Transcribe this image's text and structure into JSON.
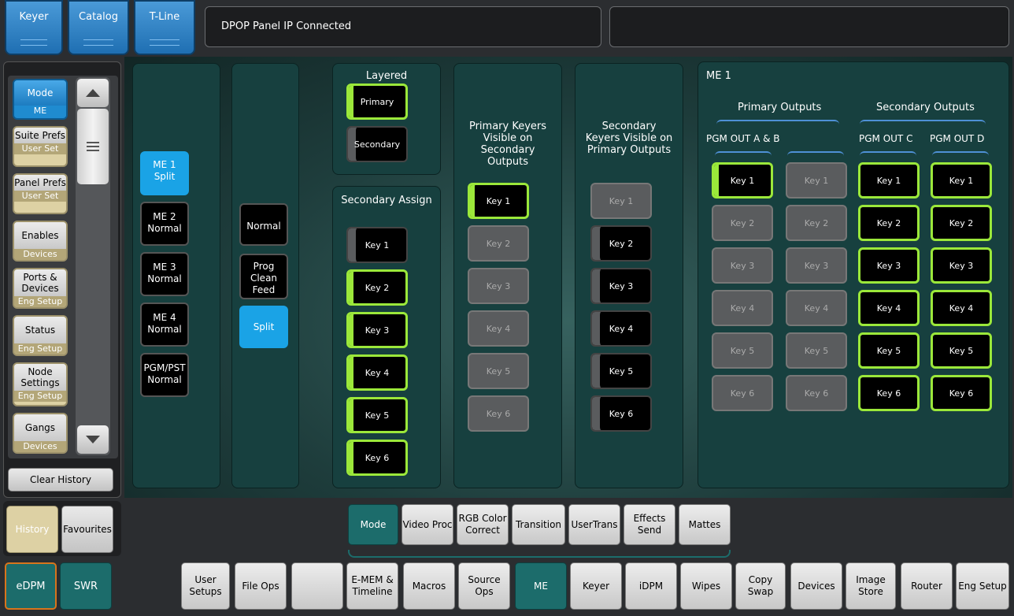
{
  "top_tabs": [
    "Keyer",
    "Catalog",
    "T-Line"
  ],
  "status_message": "DPOP Panel IP Connected",
  "sidebar": {
    "items": [
      {
        "label": "Mode",
        "sub": "ME"
      },
      {
        "label": "Suite Prefs",
        "sub": "User Set"
      },
      {
        "label": "Panel Prefs",
        "sub": "User Set"
      },
      {
        "label": "Enables",
        "sub": "Devices"
      },
      {
        "label": "Ports & Devices",
        "sub": "Eng Setup"
      },
      {
        "label": "Status",
        "sub": "Eng Setup"
      },
      {
        "label": "Node Settings",
        "sub": "Eng Setup"
      },
      {
        "label": "Gangs",
        "sub": "Devices"
      }
    ],
    "clear_history": "Clear History",
    "history": "History",
    "favourites": "Favourites",
    "edpm": "eDPM",
    "swr": "SWR"
  },
  "me_buttons": [
    {
      "line1": "ME 1",
      "line2": "Split"
    },
    {
      "line1": "ME 2",
      "line2": "Normal"
    },
    {
      "line1": "ME 3",
      "line2": "Normal"
    },
    {
      "line1": "ME 4",
      "line2": "Normal"
    },
    {
      "line1": "PGM/PST",
      "line2": "Normal"
    }
  ],
  "mode_buttons": [
    "Normal",
    "Prog Clean Feed",
    "Split"
  ],
  "layered": {
    "title": "Layered",
    "primary": "Primary",
    "secondary": "Secondary"
  },
  "secondary_assign": {
    "title": "Secondary Assign",
    "keys": [
      "Key 1",
      "Key 2",
      "Key 3",
      "Key 4",
      "Key 5",
      "Key 6"
    ]
  },
  "primary_visible": {
    "title": "Primary Keyers Visible on Secondary Outputs",
    "keys": [
      "Key 1",
      "Key 2",
      "Key 3",
      "Key 4",
      "Key 5",
      "Key 6"
    ]
  },
  "secondary_visible": {
    "title": "Secondary Keyers Visible on Primary Outputs",
    "keys": [
      "Key 1",
      "Key 2",
      "Key 3",
      "Key 4",
      "Key 5",
      "Key 6"
    ]
  },
  "me_panel": {
    "title": "ME 1",
    "primary_outputs": "Primary Outputs",
    "secondary_outputs": "Secondary Outputs",
    "pgm_ab": "PGM OUT A & B",
    "pgm_c": "PGM OUT C",
    "pgm_d": "PGM OUT D",
    "keys": [
      "Key 1",
      "Key 2",
      "Key 3",
      "Key 4",
      "Key 5",
      "Key 6"
    ]
  },
  "sub_tabs": [
    "Mode",
    "Video Proc",
    "RGB Color Correct",
    "Transition",
    "UserTrans",
    "Effects Send",
    "Mattes"
  ],
  "nav_buttons": [
    "User Setups",
    "File Ops",
    "",
    "E-MEM & Timeline",
    "Macros",
    "Source Ops",
    "ME",
    "Keyer",
    "iDPM",
    "Wipes",
    "Copy Swap",
    "Devices",
    "Image Store",
    "Router",
    "Eng Setup"
  ]
}
